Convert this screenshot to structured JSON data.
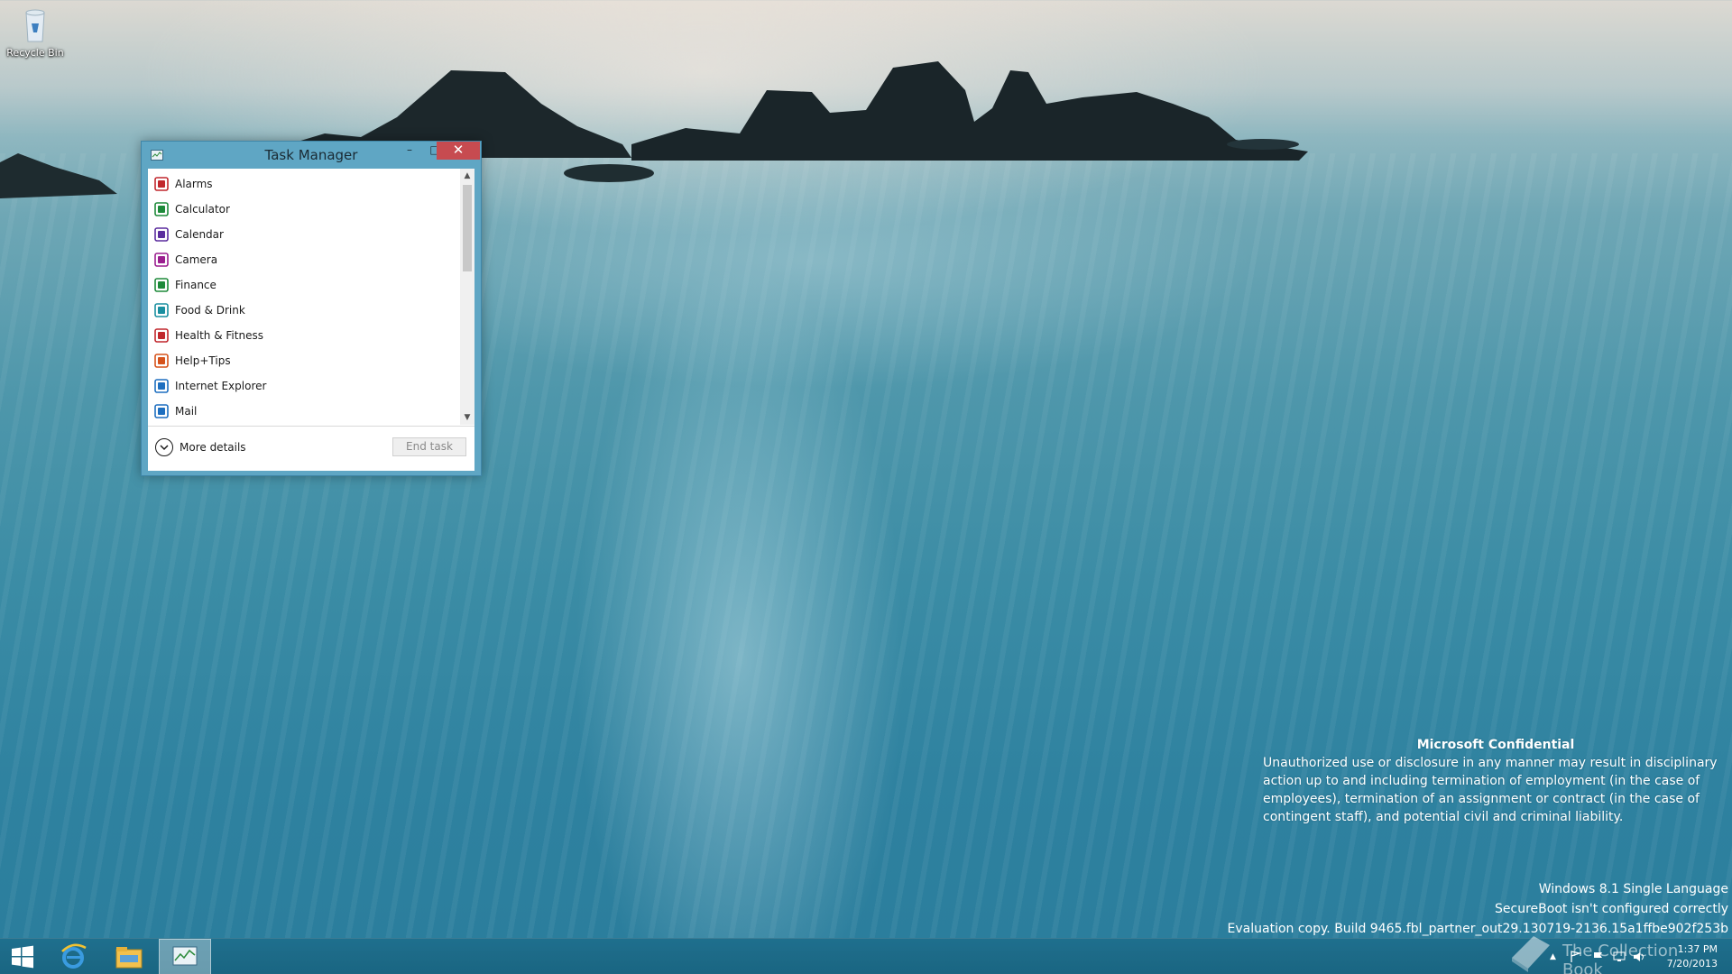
{
  "desktop": {
    "icons": [
      {
        "label": "Recycle Bin",
        "icon": "recycle-bin-icon"
      }
    ]
  },
  "task_manager": {
    "title": "Task Manager",
    "controls": {
      "minimize": "–",
      "maximize": "□",
      "close": "✕"
    },
    "apps": [
      {
        "name": "Alarms",
        "icon": "alarms-icon",
        "color": "#c1272d"
      },
      {
        "name": "Calculator",
        "icon": "calculator-icon",
        "color": "#1e8a3a"
      },
      {
        "name": "Calendar",
        "icon": "calendar-icon",
        "color": "#5b2d9e"
      },
      {
        "name": "Camera",
        "icon": "camera-icon",
        "color": "#9b1e8f"
      },
      {
        "name": "Finance",
        "icon": "finance-icon",
        "color": "#1e8a3a"
      },
      {
        "name": "Food & Drink",
        "icon": "food-drink-icon",
        "color": "#1a8fa0"
      },
      {
        "name": "Health & Fitness",
        "icon": "health-fitness-icon",
        "color": "#c1272d"
      },
      {
        "name": "Help+Tips",
        "icon": "help-tips-icon",
        "color": "#d6531c"
      },
      {
        "name": "Internet Explorer",
        "icon": "internet-explorer-icon",
        "color": "#1e6fc0"
      },
      {
        "name": "Mail",
        "icon": "mail-icon",
        "color": "#1e6fc0"
      }
    ],
    "more_details": "More details",
    "end_task": "End task"
  },
  "confidential": {
    "heading": "Microsoft Confidential",
    "body": "Unauthorized use or disclosure in any manner may result in disciplinary action up to and including termination of employment (in the case of employees), termination of an assignment or contract (in the case of contingent staff), and potential civil and criminal liability."
  },
  "build_info": {
    "line1": "Windows 8.1 Single Language",
    "line2": "SecureBoot isn't configured correctly",
    "line3": "Evaluation copy. Build 9465.fbl_partner_out29.130719-2136.15a1ffbe902f253b"
  },
  "taskbar": {
    "pinned": [
      "start-icon",
      "internet-explorer-icon",
      "file-explorer-icon",
      "task-manager-icon"
    ],
    "clock": {
      "time": "1:37 PM",
      "date": "7/20/2013"
    }
  },
  "watermark": "The Collection Book"
}
